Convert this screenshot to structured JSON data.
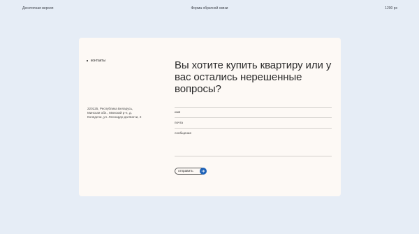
{
  "meta": {
    "left": "Десктопная версия",
    "center": "Форма обратной связи",
    "right": "1200 px"
  },
  "nav": {
    "label": "контакты"
  },
  "address": [
    "220125, Республика Беларусь,",
    "Минская обл., Минский р-н, д.",
    "Колядичи, ул. Леонардо да Винчи, 2"
  ],
  "headline": "Вы хотите купить квартиру или у вас остались нерешенные вопросы?",
  "form": {
    "name_label": "имя",
    "email_label": "почта",
    "message_label": "сообщение",
    "submit_label": "отправить"
  },
  "colors": {
    "page_bg": "#e6edf6",
    "card_bg": "#fdf9f5",
    "accent": "#1f63b8"
  }
}
